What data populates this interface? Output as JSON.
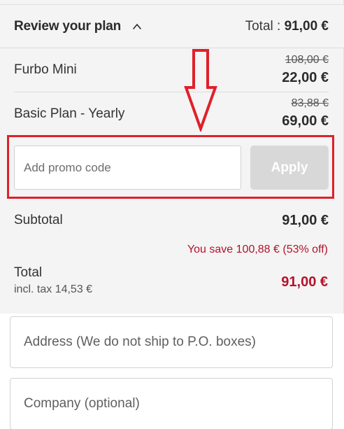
{
  "header": {
    "title": "Review your plan",
    "total_label": "Total : ",
    "total_value": "91,00 €"
  },
  "items": [
    {
      "name": "Furbo Mini",
      "old_price": "108,00 €",
      "price": "22,00 €"
    },
    {
      "name": "Basic Plan - Yearly",
      "old_price": "83,88 €",
      "price": "69,00 €"
    }
  ],
  "promo": {
    "placeholder": "Add promo code",
    "apply_label": "Apply"
  },
  "summary": {
    "subtotal_label": "Subtotal",
    "subtotal_value": "91,00 €",
    "savings_text": "You save 100,88 € (53% off)",
    "total_label": "Total",
    "tax_text": "incl. tax 14,53 €",
    "total_value": "91,00 €"
  },
  "form": {
    "address_placeholder": "Address (We do not ship to P.O. boxes)",
    "company_placeholder": "Company (optional)"
  },
  "colors": {
    "highlight": "#e0202a",
    "accent_red": "#b5122b",
    "apply_disabled": "#d8d8d8"
  },
  "icons": {
    "toggle": "chevron-up-icon",
    "annotation": "down-arrow-icon"
  }
}
